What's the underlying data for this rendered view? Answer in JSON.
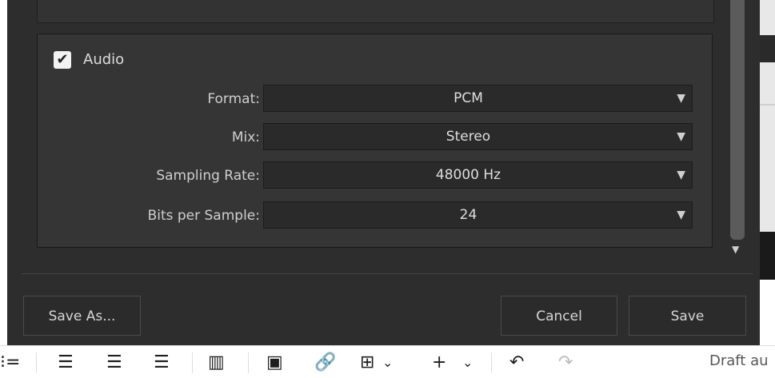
{
  "audio": {
    "enabled_label": "Audio",
    "checked": true,
    "fields": [
      {
        "label": "Format:",
        "value": "PCM"
      },
      {
        "label": "Mix:",
        "value": "Stereo"
      },
      {
        "label": "Sampling Rate:",
        "value": "48000 Hz"
      },
      {
        "label": "Bits per Sample:",
        "value": "24"
      }
    ]
  },
  "buttons": {
    "save_as": "Save As...",
    "cancel": "Cancel",
    "save": "Save"
  },
  "toolbar": {
    "icons": [
      "list-icon",
      "align-left-icon",
      "align-center-icon",
      "align-right-icon",
      "columns-icon",
      "image-icon",
      "link-icon",
      "table-icon",
      "chevron-down-icon",
      "add-icon",
      "chevron-down-icon",
      "undo-icon",
      "redo-icon"
    ],
    "status_text": "Draft au"
  },
  "colors": {
    "dialog_bg": "#2d2d2d",
    "panel_bg": "#353535",
    "field_bg": "#2a2a2a",
    "text": "#d6d6d6"
  }
}
